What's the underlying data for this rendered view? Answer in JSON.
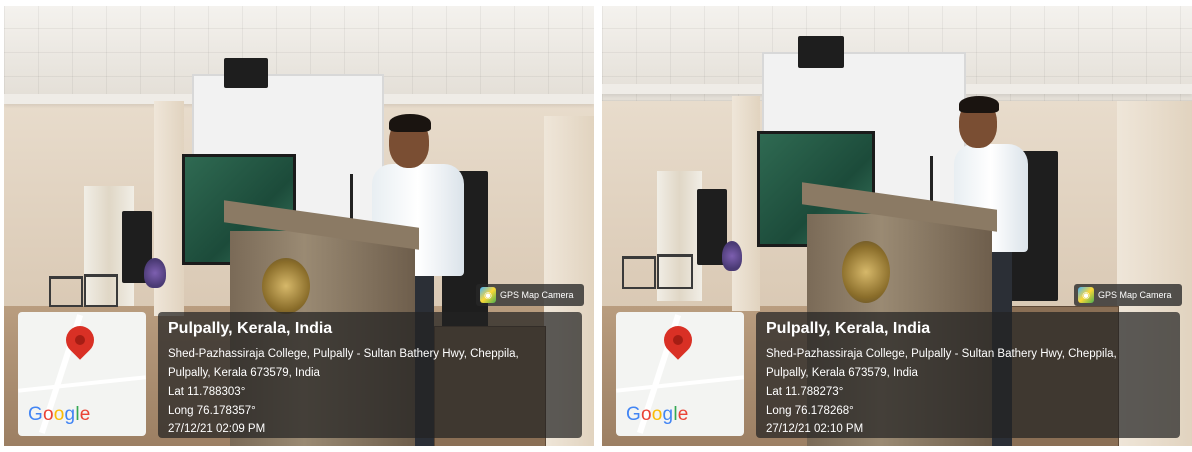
{
  "photos": [
    {
      "gps_badge": "GPS Map Camera",
      "map_logo": "Google",
      "place": "Pulpally, Kerala, India",
      "address_line1": "Shed-Pazhassiraja College, Pulpally - Sultan Bathery Hwy, Cheppila,",
      "address_line2": "Pulpally, Kerala 673579, India",
      "lat": "Lat 11.788303°",
      "long": "Long 76.178357°",
      "datetime": "27/12/21 02:09 PM"
    },
    {
      "gps_badge": "GPS Map Camera",
      "map_logo": "Google",
      "place": "Pulpally, Kerala, India",
      "address_line1": "Shed-Pazhassiraja College, Pulpally - Sultan Bathery Hwy, Cheppila,",
      "address_line2": "Pulpally, Kerala 673579, India",
      "lat": "Lat 11.788273°",
      "long": "Long 76.178268°",
      "datetime": "27/12/21 02:10 PM"
    }
  ],
  "icons": {
    "pin": "location-pin-icon",
    "gps": "gps-map-camera-icon"
  },
  "colors": {
    "pin": "#d93025",
    "overlay": "#232323"
  }
}
